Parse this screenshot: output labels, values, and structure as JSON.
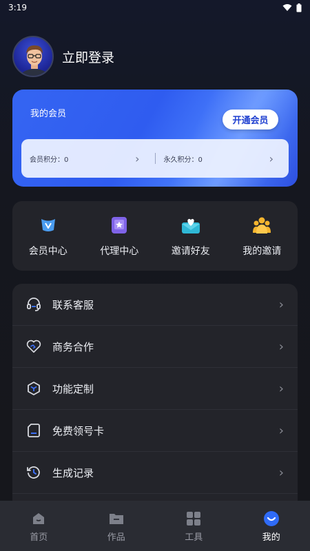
{
  "status": {
    "time": "3:19"
  },
  "profile": {
    "login_text": "立即登录"
  },
  "vip": {
    "title": "我的会员",
    "open_button": "开通会员",
    "member_points_label": "会员积分：0",
    "permanent_points_label": "永久积分：0"
  },
  "quick": [
    {
      "label": "会员中心",
      "icon": "vip-center-icon"
    },
    {
      "label": "代理中心",
      "icon": "agent-center-icon"
    },
    {
      "label": "邀请好友",
      "icon": "invite-friends-icon"
    },
    {
      "label": "我的邀请",
      "icon": "my-invites-icon"
    }
  ],
  "menu": [
    {
      "label": "联系客服",
      "icon": "headset-icon"
    },
    {
      "label": "商务合作",
      "icon": "handshake-heart-icon"
    },
    {
      "label": "功能定制",
      "icon": "cube-icon"
    },
    {
      "label": "免费领号卡",
      "icon": "sim-card-icon"
    },
    {
      "label": "生成记录",
      "icon": "history-icon"
    }
  ],
  "tabs": [
    {
      "label": "首页",
      "icon": "home-icon"
    },
    {
      "label": "作品",
      "icon": "folder-icon"
    },
    {
      "label": "工具",
      "icon": "grid-icon"
    },
    {
      "label": "我的",
      "icon": "profile-icon",
      "active": true
    }
  ],
  "colors": {
    "accent": "#2f5cf0",
    "card_bg": "#23242a",
    "tab_bg": "#2a2c33"
  }
}
